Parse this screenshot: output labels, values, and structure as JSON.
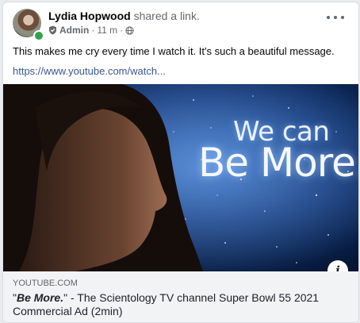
{
  "post": {
    "author": "Lydia Hopwood",
    "action": "shared a link.",
    "role": "Admin",
    "time": "11 m",
    "separator": "·",
    "text": "This makes me cry every time I watch it.  It's such a beautiful message.",
    "link": "https://www.youtube.com/watch..."
  },
  "preview": {
    "caption_line1": "We can",
    "caption_line2": "Be More."
  },
  "link_card": {
    "domain": "YOUTUBE.COM",
    "title_quote_open": "\"",
    "title_bold": "Be More.",
    "title_rest": "\" - The Scientology TV channel Super Bowl 55 2021 Commercial Ad (2min)"
  },
  "icons": {
    "more": "more-options-icon",
    "shield": "admin-shield-icon",
    "globe": "globe-icon",
    "info": "info-icon"
  },
  "colors": {
    "link": "#385898",
    "online": "#31a24c"
  }
}
